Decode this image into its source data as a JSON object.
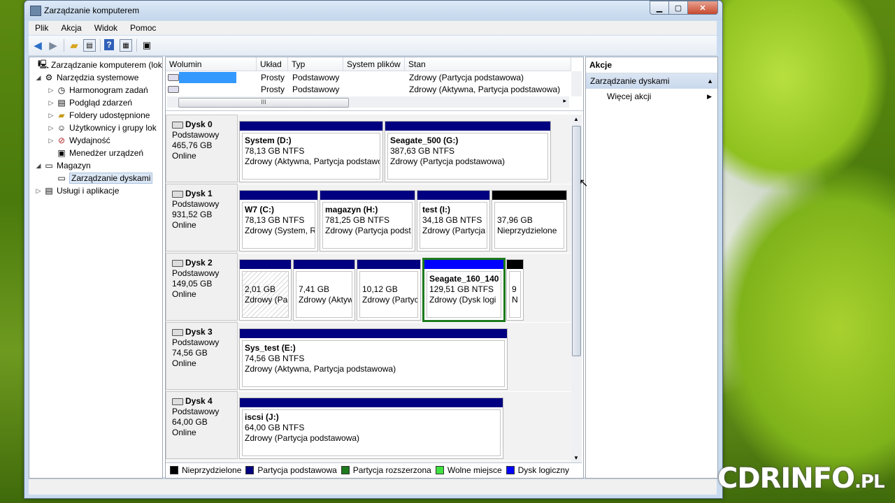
{
  "window": {
    "title": "Zarządzanie komputerem"
  },
  "menu": [
    "Plik",
    "Akcja",
    "Widok",
    "Pomoc"
  ],
  "toolbar_icons": [
    "back-arrow-icon",
    "forward-arrow-icon",
    "up-folder-icon",
    "show-hide-tree-icon",
    "help-icon",
    "properties-icon",
    "refresh-icon"
  ],
  "tree": [
    {
      "label": "Zarządzanie komputerem (loka",
      "icon": "computer-icon",
      "level": 0
    },
    {
      "label": "Narzędzia systemowe",
      "icon": "tools-icon",
      "level": 1
    },
    {
      "label": "Harmonogram zadań",
      "icon": "clock-icon",
      "level": 2
    },
    {
      "label": "Podgląd zdarzeń",
      "icon": "event-viewer-icon",
      "level": 2
    },
    {
      "label": "Foldery udostępnione",
      "icon": "shared-folder-icon",
      "level": 2
    },
    {
      "label": "Użytkownicy i grupy lok",
      "icon": "users-icon",
      "level": 2
    },
    {
      "label": "Wydajność",
      "icon": "performance-icon",
      "level": 2
    },
    {
      "label": "Menedżer urządzeń",
      "icon": "device-manager-icon",
      "level": 2
    },
    {
      "label": "Magazyn",
      "icon": "storage-icon",
      "level": 1
    },
    {
      "label": "Zarządzanie dyskami",
      "icon": "disk-management-icon",
      "level": 2
    },
    {
      "label": "Usługi i aplikacje",
      "icon": "services-icon",
      "level": 1
    }
  ],
  "volume_list": {
    "columns": [
      "Wolumin",
      "Układ",
      "Typ",
      "System plików",
      "Stan"
    ],
    "rows": [
      {
        "volume": "",
        "layout": "Prosty",
        "type": "Podstawowy",
        "fs": "",
        "status": "Zdrowy (Partycja podstawowa)"
      },
      {
        "volume": "",
        "layout": "Prosty",
        "type": "Podstawowy",
        "fs": "",
        "status": "Zdrowy (Aktywna, Partycja podstawowa)"
      }
    ],
    "scroll_label": "III"
  },
  "disks": [
    {
      "name": "Dysk 0",
      "type": "Podstawowy",
      "size": "465,76 GB",
      "state": "Online",
      "partitions": [
        {
          "name": "System  (D:)",
          "size": "78,13 GB NTFS",
          "status": "Zdrowy (Aktywna, Partycja podstawowa)"
        },
        {
          "name": "Seagate_500  (G:)",
          "size": "387,63 GB NTFS",
          "status": "Zdrowy (Partycja podstawowa)"
        }
      ]
    },
    {
      "name": "Dysk 1",
      "type": "Podstawowy",
      "size": "931,52 GB",
      "state": "Online",
      "partitions": [
        {
          "name": "W7  (C:)",
          "size": "78,13 GB NTFS",
          "status": "Zdrowy (System, R"
        },
        {
          "name": "magazyn  (H:)",
          "size": "781,25 GB NTFS",
          "status": "Zdrowy (Partycja podst"
        },
        {
          "name": "test  (I:)",
          "size": "34,18 GB NTFS",
          "status": "Zdrowy (Partycja"
        },
        {
          "name": "",
          "size": "37,96 GB",
          "status": "Nieprzydzielone"
        }
      ]
    },
    {
      "name": "Dysk 2",
      "type": "Podstawowy",
      "size": "149,05 GB",
      "state": "Online",
      "partitions": [
        {
          "name": "",
          "size": "2,01 GB",
          "status": "Zdrowy (Pa"
        },
        {
          "name": "",
          "size": "7,41 GB",
          "status": "Zdrowy (Aktyw"
        },
        {
          "name": "",
          "size": "10,12 GB",
          "status": "Zdrowy (Partyc"
        },
        {
          "name": "Seagate_160_140",
          "size": "129,51 GB NTFS",
          "status": "Zdrowy (Dysk logi"
        },
        {
          "name": "",
          "size": "9",
          "status": "N"
        }
      ]
    },
    {
      "name": "Dysk 3",
      "type": "Podstawowy",
      "size": "74,56 GB",
      "state": "Online",
      "partitions": [
        {
          "name": "Sys_test  (E:)",
          "size": "74,56 GB NTFS",
          "status": "Zdrowy (Aktywna, Partycja podstawowa)"
        }
      ]
    },
    {
      "name": "Dysk 4",
      "type": "Podstawowy",
      "size": "64,00 GB",
      "state": "Online",
      "partitions": [
        {
          "name": "iscsi  (J:)",
          "size": "64,00 GB NTFS",
          "status": "Zdrowy (Partycja podstawowa)"
        }
      ]
    }
  ],
  "legend": [
    {
      "label": "Nieprzydzielone",
      "color": "#000000"
    },
    {
      "label": "Partycja podstawowa",
      "color": "#000080"
    },
    {
      "label": "Partycja rozszerzona",
      "color": "#1c7a1c"
    },
    {
      "label": "Wolne miejsce",
      "color": "#3fe03f"
    },
    {
      "label": "Dysk logiczny",
      "color": "#0000ff"
    }
  ],
  "actions": {
    "header": "Akcje",
    "section": "Zarządzanie dyskami",
    "items": [
      "Więcej akcji"
    ]
  },
  "watermark": {
    "main": "CDRINFO",
    "suffix": ".PL"
  },
  "colors": {
    "primary_partition": "#000080",
    "unallocated": "#000000",
    "extended": "#1c7a1c",
    "logical": "#0000ff",
    "selection": "#3399ff"
  }
}
